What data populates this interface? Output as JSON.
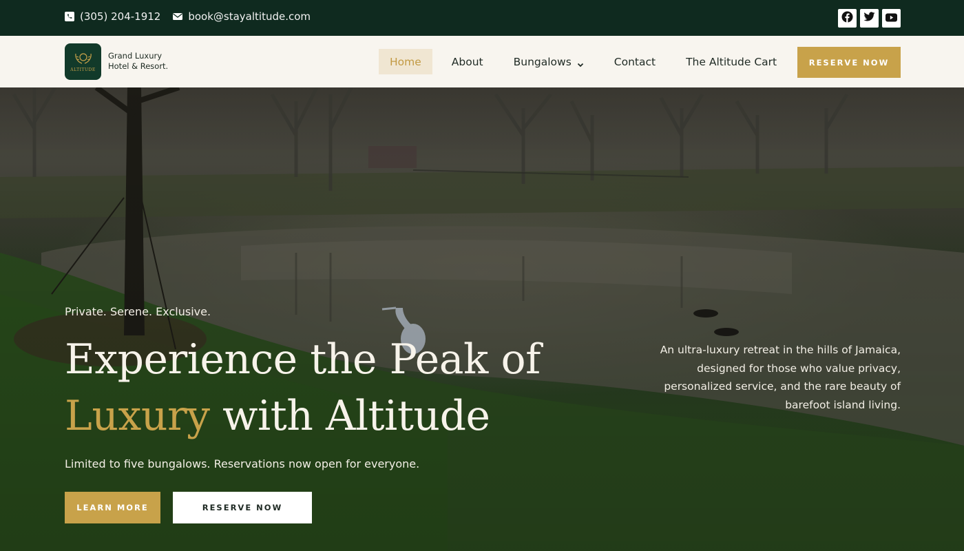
{
  "topbar": {
    "phone": "(305) 204-1912",
    "email": "book@stayaltitude.com",
    "socials": [
      {
        "icon": "facebook-icon"
      },
      {
        "icon": "twitter-icon"
      },
      {
        "icon": "youtube-icon"
      }
    ]
  },
  "header": {
    "logo_text": "ALTITUDE",
    "brand_line1": "Grand Luxury",
    "brand_line2": "Hotel & Resort.",
    "nav": [
      {
        "label": "Home",
        "active": true
      },
      {
        "label": "About"
      },
      {
        "label": "Bungalows",
        "has_dropdown": true
      },
      {
        "label": "Contact"
      },
      {
        "label": "The Altitude Cart"
      }
    ],
    "reserve_label": "RESERVE NOW"
  },
  "hero": {
    "tagline": "Private. Serene. Exclusive.",
    "headline_part1": "Experience the Peak of",
    "headline_gold": "Luxury",
    "headline_part2": " with Altitude",
    "subtext": "Limited to five bungalows. Reservations now open for everyone.",
    "learn_more_label": "LEARN MORE",
    "reserve_label": "RESERVE NOW",
    "description": "An ultra-luxury retreat in the hills of Jamaica, designed for those who value privacy, personalized service, and the rare beauty of barefoot island living."
  },
  "colors": {
    "dark_green": "#0f2a1f",
    "gold": "#c8a24a",
    "cream": "#f8f5ef"
  }
}
